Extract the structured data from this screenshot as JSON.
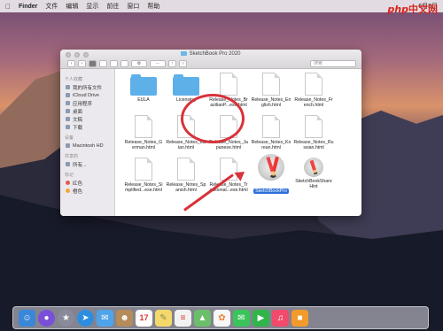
{
  "menubar": {
    "apple": "",
    "app_name": "Finder",
    "items": [
      "文件",
      "编辑",
      "显示",
      "前往",
      "窗口",
      "帮助"
    ],
    "time": "6月8日"
  },
  "watermark": {
    "brand": "php",
    "cn": "中文网"
  },
  "window": {
    "title": "SketchBook Pro 2020",
    "search_placeholder": "搜索",
    "sidebar": {
      "favorites_heading": "个人收藏",
      "favorites": [
        "我的所有文件",
        "iCloud Drive",
        "应用程序",
        "桌面",
        "文稿",
        "下载"
      ],
      "devices_heading": "设备",
      "devices": [
        "Macintosh HD"
      ],
      "shared_heading": "共享的",
      "shared": [
        "所有..."
      ],
      "tags_heading": "标记",
      "tags": [
        "红色",
        "橙色"
      ]
    },
    "files": [
      {
        "name": "EULA",
        "kind": "folder"
      },
      {
        "name": "Licensing",
        "kind": "folder"
      },
      {
        "name": "Release_Notes_Br azilianP...ese.html",
        "kind": "doc"
      },
      {
        "name": "Release_Notes_En glish.html",
        "kind": "doc"
      },
      {
        "name": "Release_Notes_Fr ench.html",
        "kind": "doc"
      },
      {
        "name": "Release_Notes_G erman.html",
        "kind": "doc"
      },
      {
        "name": "Release_Notes_Ital ian.html",
        "kind": "doc"
      },
      {
        "name": "Release_Notes_Ja panese.html",
        "kind": "doc"
      },
      {
        "name": "Release_Notes_Ko rean.html",
        "kind": "doc"
      },
      {
        "name": "Release_Notes_Ru ssian.html",
        "kind": "doc"
      },
      {
        "name": "Release_Notes_Si mplified...ese.html",
        "kind": "doc"
      },
      {
        "name": "Release_Notes_Sp anish.html",
        "kind": "doc"
      },
      {
        "name": "Release_Notes_Tr aditional...ese.html",
        "kind": "doc"
      },
      {
        "name": "SketchBookPro",
        "kind": "app",
        "selected": true
      },
      {
        "name": "SketchBookShare Hint",
        "kind": "app2"
      }
    ]
  },
  "dock": {
    "icons": [
      "finder-icon",
      "siri-icon",
      "launchpad-icon",
      "safari-icon",
      "mail-icon",
      "contacts-icon",
      "calendar-icon",
      "notes-icon",
      "reminders-icon",
      "maps-icon",
      "photos-icon",
      "messages-icon",
      "facetime-icon",
      "music-icon",
      "books-icon"
    ],
    "calendar_day": "17"
  },
  "colors": {
    "accent": "#2d6fd8",
    "annotation": "#d8323a",
    "folder": "#5db0e8"
  }
}
